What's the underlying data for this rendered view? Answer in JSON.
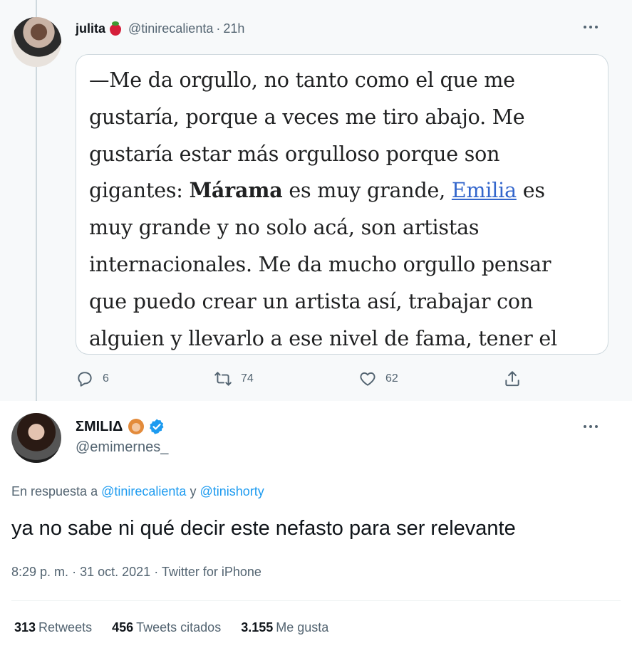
{
  "reply_tweet": {
    "name": "julita",
    "name_emoji": "strawberry-icon",
    "handle": "@tinirecalienta",
    "separator": "·",
    "time": "21h",
    "quote_lines": [
      {
        "parts": [
          {
            "text": "—Me da orgullo, no tanto como el que me"
          }
        ]
      },
      {
        "parts": [
          {
            "text": "gustaría, porque a veces me tiro abajo. Me"
          }
        ]
      },
      {
        "parts": [
          {
            "text": "gustaría estar más orgulloso porque son"
          }
        ]
      },
      {
        "parts": [
          {
            "text": "gigantes: "
          },
          {
            "text": "Márama",
            "style": "bold"
          },
          {
            "text": " es muy grande, "
          },
          {
            "text": "Emilia",
            "style": "link"
          },
          {
            "text": " es"
          }
        ]
      },
      {
        "parts": [
          {
            "text": "muy grande y no solo acá, son artistas"
          }
        ]
      },
      {
        "parts": [
          {
            "text": "internacionales. Me da mucho orgullo pensar"
          }
        ]
      },
      {
        "parts": [
          {
            "text": "que puedo crear un artista así, trabajar con"
          }
        ]
      },
      {
        "parts": [
          {
            "text": "alguien y llevarlo a ese nivel de fama, tener el"
          }
        ]
      }
    ],
    "actions": {
      "replies": "6",
      "retweets": "74",
      "likes": "62"
    }
  },
  "main_tweet": {
    "name": "ΣMILIΔ",
    "name_emoji": "woman-icon",
    "verified": true,
    "handle": "@emimernes_",
    "in_reply_prefix": "En respuesta a",
    "in_reply_mention_1": "@tinirecalienta",
    "in_reply_and": "y",
    "in_reply_mention_2": "@tinishorty",
    "text": "ya no sabe ni qué decir este nefasto para ser relevante",
    "time": "8:29 p. m.",
    "date": "31 oct. 2021",
    "source": "Twitter for iPhone",
    "separator": "·",
    "stats": {
      "retweets_count": "313",
      "retweets_label": "Retweets",
      "quotes_count": "456",
      "quotes_label": "Tweets citados",
      "likes_count": "3.155",
      "likes_label": "Me gusta"
    }
  },
  "colors": {
    "accent": "#1d9bf0",
    "secondary_text": "#536471",
    "reply_background": "#f7f9fa",
    "link": "#3366cc"
  }
}
